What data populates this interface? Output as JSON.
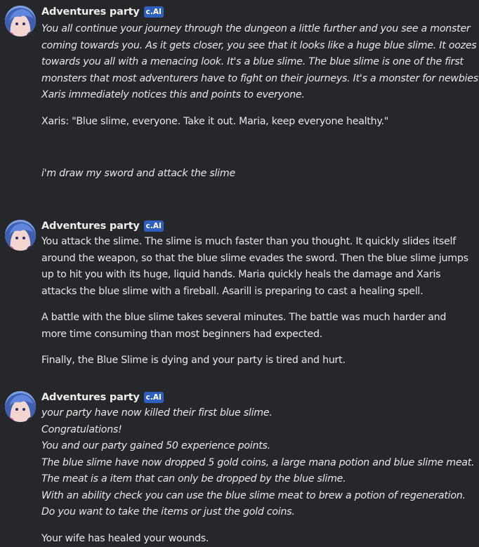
{
  "messages": [
    {
      "character": "Adventures party",
      "badge": "c.AI",
      "paragraphs": {
        "p1_lines": [
          "You all continue your journey through the dungeon a little further and you see a monster",
          "coming towards you. As it gets closer, you see that it looks like a huge blue slime. It oozes",
          "towards you all with a menacing look. It's a blue slime. The blue slime is one of the first",
          "monsters that most adventurers have to fight on their journeys. It's a monster for newbies.",
          "Xaris immediately notices this and points to everyone."
        ],
        "p2": "Xaris: \"Blue slime, everyone. Take it out. Maria, keep everyone healthy.\""
      }
    },
    {
      "user_text": "i'm draw my sword and attack the slime"
    },
    {
      "character": "Adventures party",
      "badge": "c.AI",
      "paragraphs": {
        "p1_lines": [
          "You attack the slime. The slime is much faster than you thought. It quickly slides itself",
          "around the weapon, so that the blue slime evades the sword. Then the blue slime jumps",
          "up to hit you with its huge, liquid hands. Maria quickly heals the damage and Xaris",
          "attacks the blue slime with a fireball. Asarill is preparing to cast a healing spell."
        ],
        "p2_lines": [
          "A battle with the blue slime takes several minutes. The battle was much harder and",
          "more time consuming than most beginners had expected."
        ],
        "p3": "Finally, the Blue Slime is dying and your party is tired and hurt."
      }
    },
    {
      "character": "Adventures party",
      "badge": "c.AI",
      "paragraphs": {
        "p1_lines": [
          "your party have now killed their first blue slime.",
          "Congratulations!",
          "You and our party gained 50 experience points.",
          "The blue slime have now dropped 5 gold coins, a large mana potion and blue slime meat.",
          "The meat is a item that can only be dropped by the blue slime.",
          "With an ability check you can use the blue slime meat to brew a potion of regeneration.",
          "Do you want to take the items or just the gold coins."
        ],
        "p2": "Your wife has healed your wounds."
      }
    }
  ]
}
